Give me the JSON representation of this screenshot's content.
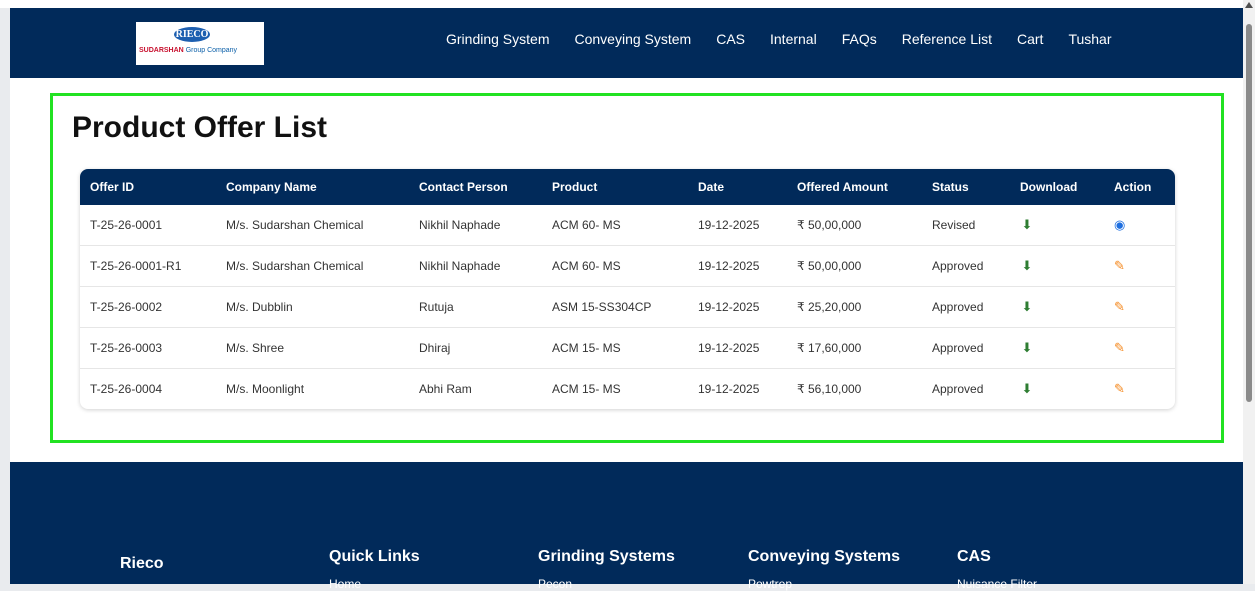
{
  "nav": {
    "logo": {
      "top": "RIECO",
      "brand": "SUDARSHAN",
      "brand_suffix": "Group Company"
    },
    "items": [
      "Grinding System",
      "Conveying System",
      "CAS",
      "Internal",
      "FAQs",
      "Reference List",
      "Cart",
      "Tushar"
    ]
  },
  "page": {
    "title": "Product Offer List"
  },
  "table": {
    "headers": [
      "Offer ID",
      "Company Name",
      "Contact Person",
      "Product",
      "Date",
      "Offered Amount",
      "Status",
      "Download",
      "Action"
    ],
    "rows": [
      {
        "offer_id": "T-25-26-0001",
        "company": "M/s. Sudarshan Chemical",
        "contact": "Nikhil Naphade",
        "product": "ACM 60- MS",
        "date": "19-12-2025",
        "amount": "₹ 50,00,000",
        "status": "Revised",
        "action_icon": "eye-icon"
      },
      {
        "offer_id": "T-25-26-0001-R1",
        "company": "M/s. Sudarshan Chemical",
        "contact": "Nikhil Naphade",
        "product": "ACM 60- MS",
        "date": "19-12-2025",
        "amount": "₹ 50,00,000",
        "status": "Approved",
        "action_icon": "edit-icon"
      },
      {
        "offer_id": "T-25-26-0002",
        "company": "M/s. Dubblin",
        "contact": "Rutuja",
        "product": "ASM 15-SS304CP",
        "date": "19-12-2025",
        "amount": "₹ 25,20,000",
        "status": "Approved",
        "action_icon": "edit-icon"
      },
      {
        "offer_id": "T-25-26-0003",
        "company": "M/s. Shree",
        "contact": "Dhiraj",
        "product": "ACM 15- MS",
        "date": "19-12-2025",
        "amount": "₹ 17,60,000",
        "status": "Approved",
        "action_icon": "edit-icon"
      },
      {
        "offer_id": "T-25-26-0004",
        "company": "M/s. Moonlight",
        "contact": "Abhi Ram",
        "product": "ACM 15- MS",
        "date": "19-12-2025",
        "amount": "₹ 56,10,000",
        "status": "Approved",
        "action_icon": "edit-icon"
      }
    ]
  },
  "footer": {
    "brand": "Rieco",
    "columns": [
      {
        "heading": "Quick Links",
        "first_link": "Home"
      },
      {
        "heading": "Grinding Systems",
        "first_link": "Pecon"
      },
      {
        "heading": "Conveying Systems",
        "first_link": "Powtrep"
      },
      {
        "heading": "CAS",
        "first_link": "Nuisance Filter"
      }
    ]
  },
  "colors": {
    "navy": "#012a5a",
    "highlight": "#22e222",
    "download": "#2e7d32",
    "view": "#1e6fe0",
    "edit": "#f5891f"
  }
}
